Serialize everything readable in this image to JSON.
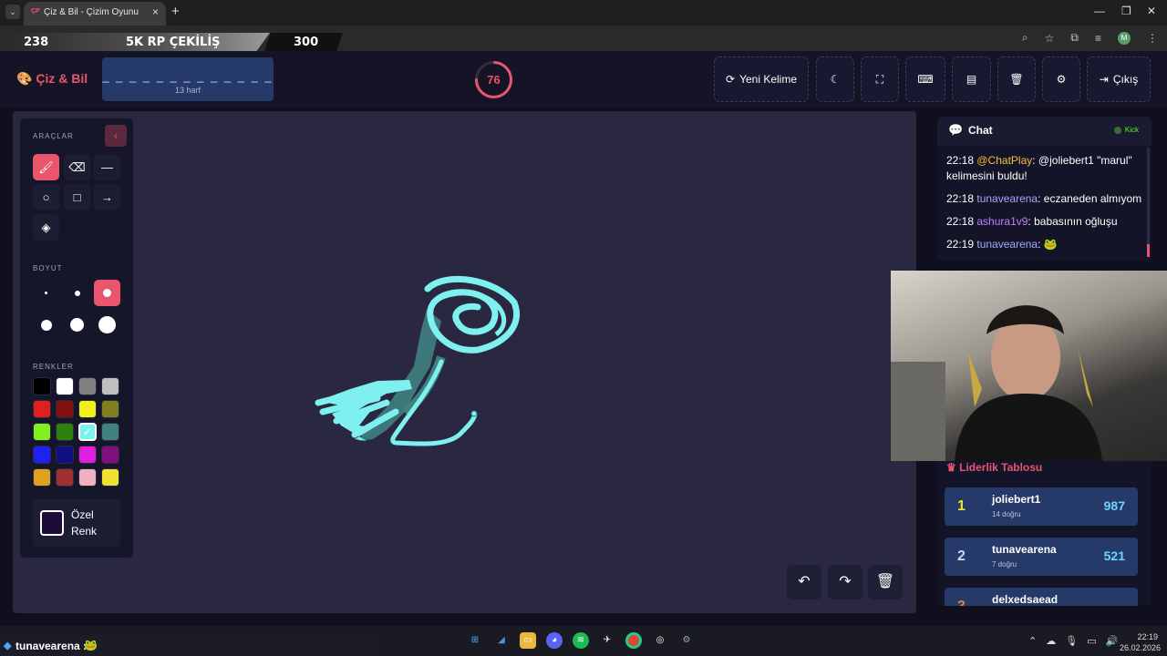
{
  "browser": {
    "tab_icon": "ÇP",
    "tab_title": "Çiz & Bil - Çizim Oyunu",
    "tab_close": "×",
    "new_tab": "+",
    "avatar_letter": "M"
  },
  "banner": {
    "left_number": "238",
    "center_text": "5K RP ÇEKİLİŞ",
    "right_number": "300"
  },
  "header": {
    "logo": "Çiz & Bil",
    "word_hint": "_ _ _ _ _ _ _ _ _ _ _ _ _",
    "word_length": "13 harf",
    "timer": "76",
    "timer_progress": 0.76,
    "new_word_label": "Yeni Kelime",
    "exit_label": "Çıkış"
  },
  "tools": {
    "section_label": "ARAÇLAR",
    "size_label": "BOYUT",
    "colors_label": "RENKLER",
    "custom_color_label_1": "Özel",
    "custom_color_label_2": "Renk",
    "active_tool": "brush",
    "active_size": 3,
    "selected_color": "#7ff0f0",
    "palette": [
      "#000000",
      "#ffffff",
      "#808080",
      "#c0c0c0",
      "#e02020",
      "#801010",
      "#f0f020",
      "#808020",
      "#80f020",
      "#308010",
      "#7ff0f0",
      "#408080",
      "#2020f0",
      "#101080",
      "#e020e0",
      "#801080",
      "#e0a020",
      "#a03030",
      "#f0b0c0",
      "#f0e030"
    ],
    "custom_color": "#1c0a3a"
  },
  "chat": {
    "title": "Chat",
    "platform": "Kick",
    "messages": [
      {
        "time": "22:18",
        "user": "@ChatPlay",
        "user_color": "#f0c040",
        "text": ": @joliebert1 \"marul\" kelimesini buldu!"
      },
      {
        "time": "22:18",
        "user": "tunavearena",
        "user_color": "#a0a8ff",
        "text": ": eczaneden almıyom"
      },
      {
        "time": "22:18",
        "user": "ashura1v9",
        "user_color": "#c080ff",
        "text": ": babasının oğluşu"
      },
      {
        "time": "22:19",
        "user": "tunavearena",
        "user_color": "#a0a8ff",
        "text": ": 🐸"
      }
    ]
  },
  "leaderboard": {
    "title": "Liderlik Tablosu",
    "rows": [
      {
        "rank": "1",
        "name": "joliebert1",
        "sub": "14 doğru",
        "score": "987",
        "rank_color": "#f0e030"
      },
      {
        "rank": "2",
        "name": "tunavearena",
        "sub": "7 doğru",
        "score": "521",
        "rank_color": "#d0d8e8"
      },
      {
        "rank": "3",
        "name": "delxedsaead",
        "sub": "",
        "score": "",
        "rank_color": "#e08040"
      }
    ]
  },
  "overlay_chat": {
    "user": "tunavearena :",
    "emote": "🐸"
  },
  "clock": {
    "time": "22:19",
    "date": "26.02.2026"
  }
}
